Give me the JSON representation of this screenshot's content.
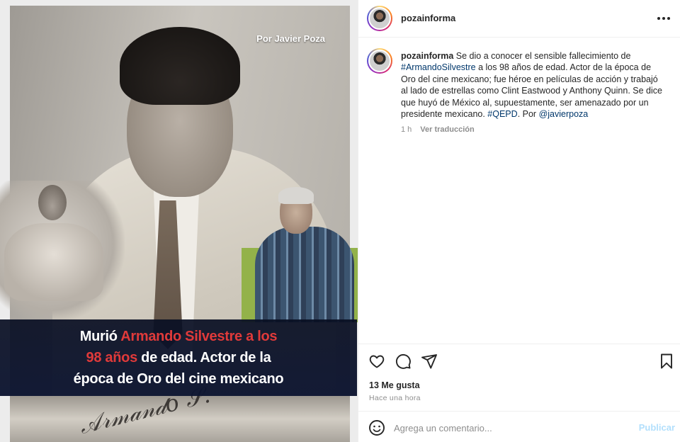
{
  "post": {
    "byline": "Por Javier Poza",
    "banner": {
      "line1_pre": "Murió ",
      "line1_red": "Armando Silvestre a los",
      "line2_red": "98 años",
      "line2_post": " de edad. Actor de la",
      "line3": "época de Oro del cine mexicano"
    },
    "signature": "Armando S."
  },
  "header": {
    "username": "pozainforma",
    "more_icon": "more-horizontal-icon"
  },
  "caption": {
    "username": "pozainforma",
    "text_1": " Se dio a conocer el sensible fallecimiento de ",
    "hashtag_1": "#ArmandoSilvestre",
    "text_2": " a los 98 años de edad. Actor de la época de Oro del cine mexicano; fue héroe en películas de acción y trabajó al lado de estrellas como Clint Eastwood y Anthony Quinn. Se dice que huyó de México al, supuestamente, ser amenazado por un presidente mexicano. ",
    "hashtag_2": "#QEPD",
    "text_3": ". Por ",
    "mention": "@javierpoza",
    "time": "1 h",
    "translate": "Ver traducción"
  },
  "actions": {
    "icons": [
      "heart-icon",
      "comment-icon",
      "share-icon",
      "bookmark-icon"
    ],
    "likes": "13 Me gusta",
    "time": "Hace una hora"
  },
  "comment": {
    "placeholder": "Agrega un comentario...",
    "post_label": "Publicar"
  },
  "colors": {
    "link": "#00376b",
    "muted": "#8e8e8e",
    "banner_red": "#e03a3a",
    "post_disabled": "#b2dffc"
  }
}
